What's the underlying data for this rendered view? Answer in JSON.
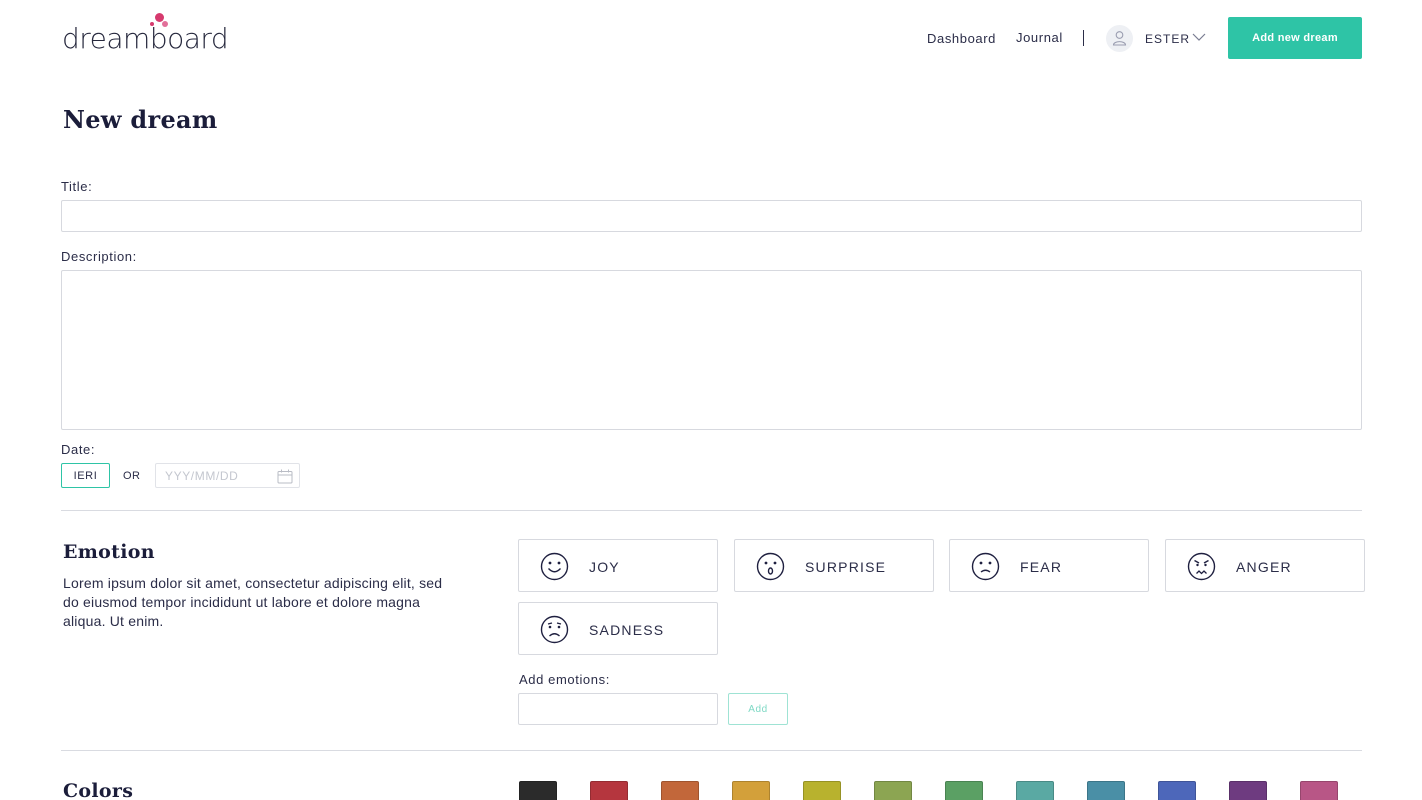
{
  "header": {
    "logo_text": "dreamboard",
    "logo_color": "#d63a6e",
    "nav": {
      "dashboard": "Dashboard",
      "journal": "Journal"
    },
    "user": {
      "name": "ESTER",
      "avatar_icon": "user-icon",
      "menu_icon": "chevron-down-icon"
    },
    "add_button_label": "Add new dream",
    "accent_color": "#2ec4a6"
  },
  "page_title": "New dream",
  "form": {
    "title_label": "Title:",
    "title_value": "",
    "description_label": "Description:",
    "description_value": "",
    "date_label": "Date:",
    "date_quick_option": "IERI",
    "date_or": "OR",
    "date_placeholder": "YYY/MM/DD",
    "date_icon": "calendar-icon"
  },
  "emotion": {
    "title": "Emotion",
    "description": "Lorem ipsum dolor sit amet, consectetur adipiscing elit, sed do eiusmod tempor incididunt ut labore et dolore magna aliqua. Ut enim.",
    "options": [
      {
        "label": "JOY",
        "icon": "smile-icon"
      },
      {
        "label": "SURPRISE",
        "icon": "surprised-face-icon"
      },
      {
        "label": "FEAR",
        "icon": "frown-icon"
      },
      {
        "label": "ANGER",
        "icon": "angry-face-icon"
      },
      {
        "label": "SADNESS",
        "icon": "sad-face-icon"
      }
    ],
    "add_label": "Add emotions:",
    "add_value": "",
    "add_button": "Add"
  },
  "colors": {
    "title": "Colors",
    "swatches": [
      "#2b2b2b",
      "#b5363e",
      "#c2673a",
      "#d3a03a",
      "#b8b22e",
      "#8ca552",
      "#5ba064",
      "#5aa9a3",
      "#4a8fa6",
      "#4d67ba",
      "#6e3b80",
      "#b85686"
    ]
  }
}
